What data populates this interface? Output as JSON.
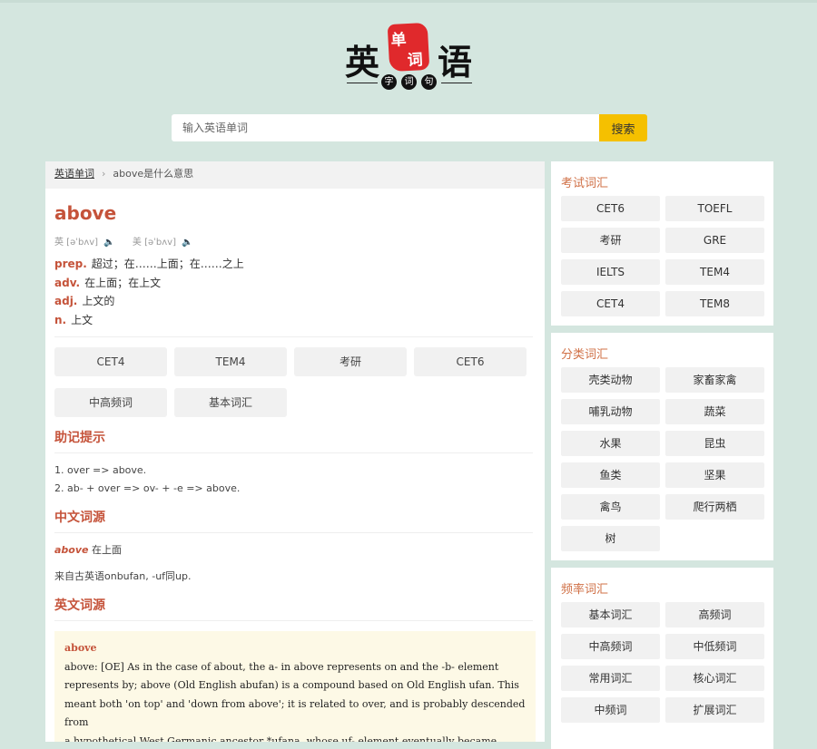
{
  "logo": {
    "char1": "英",
    "seal1": "单",
    "seal2": "词",
    "char2": "语",
    "sub": [
      "字",
      "词",
      "句"
    ]
  },
  "search": {
    "placeholder": "输入英语单词",
    "button": "搜索"
  },
  "breadcrumb": {
    "home": "英语单词",
    "sep": "›",
    "current": "above是什么意思"
  },
  "entry": {
    "word": "above",
    "uk_label": "英 [əˈbʌv]",
    "us_label": "美 [əˈbʌv]",
    "speaker_icon": "speaker-icon",
    "defs": [
      {
        "pos": "prep.",
        "text": "超过；在……上面；在……之上"
      },
      {
        "pos": "adv.",
        "text": "在上面；在上文"
      },
      {
        "pos": "adj.",
        "text": "上文的"
      },
      {
        "pos": "n.",
        "text": "上文"
      }
    ],
    "tags": [
      "CET4",
      "TEM4",
      "考研",
      "CET6",
      "中高频词",
      "基本词汇"
    ]
  },
  "mnemonic": {
    "title": "助记提示",
    "lines": [
      "1. over => above.",
      "2. ab- + over => ov- + -e => above."
    ]
  },
  "cn_ety": {
    "title": "中文词源",
    "word": "above",
    "gloss": "在上面",
    "line": "来自古英语onbufan, -uf同up."
  },
  "en_ety": {
    "title": "英文词源",
    "head": "above",
    "text": [
      "above: [OE] As in the case of about, the a- in above represents on and the -b- element",
      "represents by; above (Old English abufan) is a compound based on Old English ufan. This",
      "meant both 'on top' and 'down from above'; it is related to over, and is probably descended from",
      "a hypothetical West Germanic ancestor *ufana, whose uf- element eventually became modern"
    ]
  },
  "sidebar": {
    "exam": {
      "title": "考试词汇",
      "items": [
        "CET6",
        "TOEFL",
        "考研",
        "GRE",
        "IELTS",
        "TEM4",
        "CET4",
        "TEM8"
      ]
    },
    "category": {
      "title": "分类词汇",
      "items": [
        "壳类动物",
        "家畜家禽",
        "哺乳动物",
        "蔬菜",
        "水果",
        "昆虫",
        "鱼类",
        "坚果",
        "禽鸟",
        "爬行两栖",
        "树"
      ]
    },
    "frequency": {
      "title": "频率词汇",
      "items": [
        "基本词汇",
        "高频词",
        "中高频词",
        "中低频词",
        "常用词汇",
        "核心词汇",
        "中频词",
        "扩展词汇"
      ]
    }
  }
}
